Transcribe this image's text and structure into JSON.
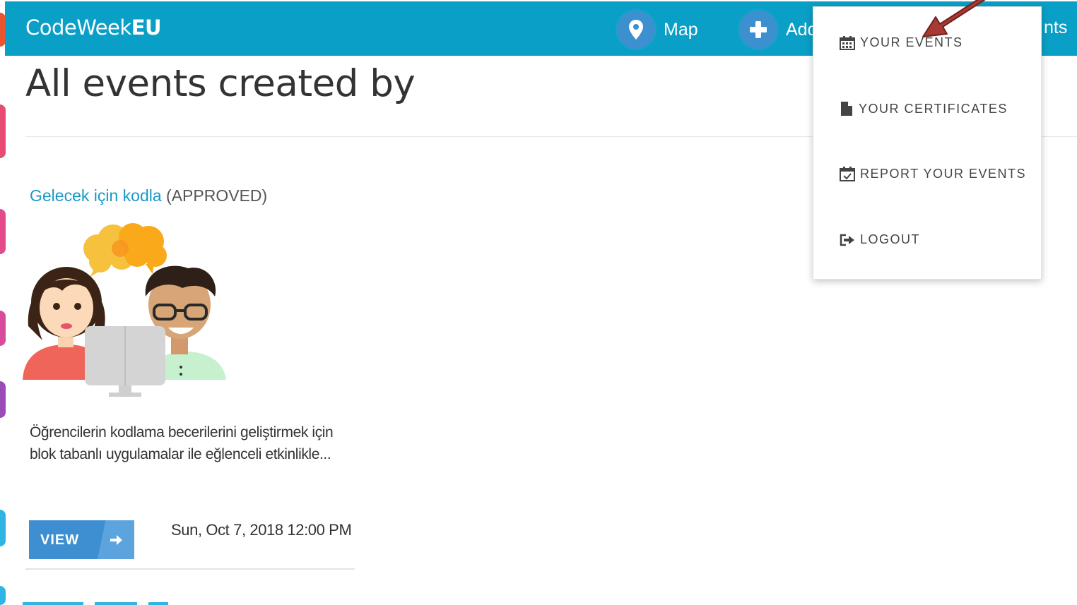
{
  "header": {
    "brand_main": "CodeWeek",
    "brand_suffix": "EU",
    "nav": {
      "map_label": "Map",
      "add_label": "Add",
      "partial_label": "nts"
    }
  },
  "page": {
    "title": "All events created by"
  },
  "event": {
    "title": "Gelecek için kodla",
    "status": "(APPROVED)",
    "description": "Öğrencilerin kodlama becerilerini geliştirmek için blok tabanlı uygulamalar ile eğlenceli etkinlikle...",
    "view_label": "VIEW",
    "date": "Sun, Oct 7, 2018 12:00 PM"
  },
  "dropdown": {
    "items": [
      {
        "label": "YOUR EVENTS",
        "icon": "calendar-icon"
      },
      {
        "label": "YOUR CERTIFICATES",
        "icon": "file-icon"
      },
      {
        "label": "REPORT YOUR EVENTS",
        "icon": "calendar-check-icon"
      },
      {
        "label": "LOGOUT",
        "icon": "sign-out-icon"
      }
    ]
  },
  "colors": {
    "header_bg": "#0a9fc6",
    "nav_circle": "#3c90cf",
    "link": "#1a98c6",
    "button": "#3d8fd1",
    "annotation_arrow": "#a83a34"
  }
}
